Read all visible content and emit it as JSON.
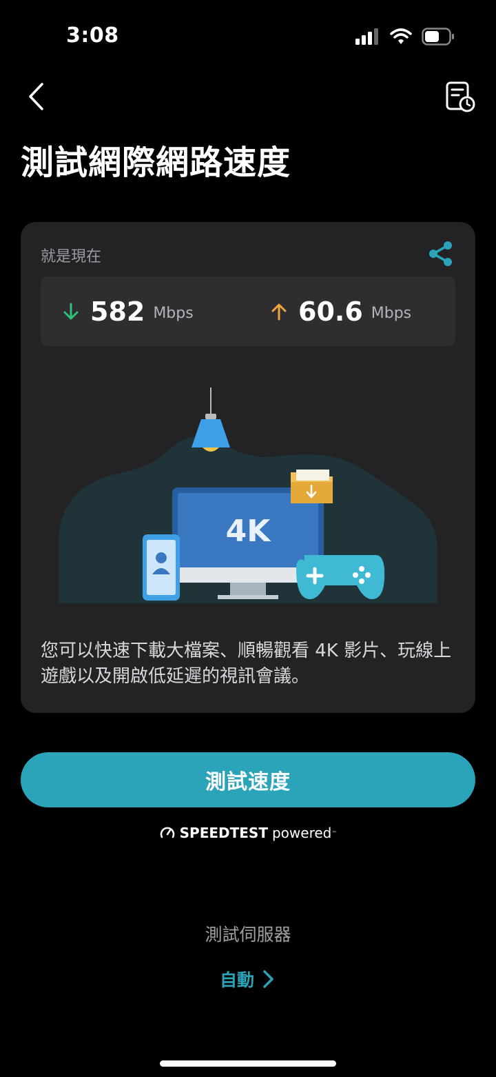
{
  "status_bar": {
    "time": "3:08"
  },
  "header": {
    "title": "測試網際網路速度"
  },
  "card": {
    "label": "就是現在",
    "download": {
      "value": "582",
      "unit": "Mbps"
    },
    "upload": {
      "value": "60.6",
      "unit": "Mbps"
    },
    "illustration_text": "4K",
    "description": "您可以快速下載大檔案、順暢觀看 4K 影片、玩線上遊戲以及開啟低延遲的視訊會議。"
  },
  "actions": {
    "test_button_label": "測試速度"
  },
  "branding": {
    "brand": "SPEEDTEST",
    "powered": "powered",
    "tm": "™"
  },
  "server": {
    "label": "測試伺服器",
    "value": "自動"
  },
  "colors": {
    "accent": "#2ba3b9",
    "download_arrow": "#2ec37a",
    "upload_arrow": "#f2a53a",
    "card_bg": "#232326"
  }
}
